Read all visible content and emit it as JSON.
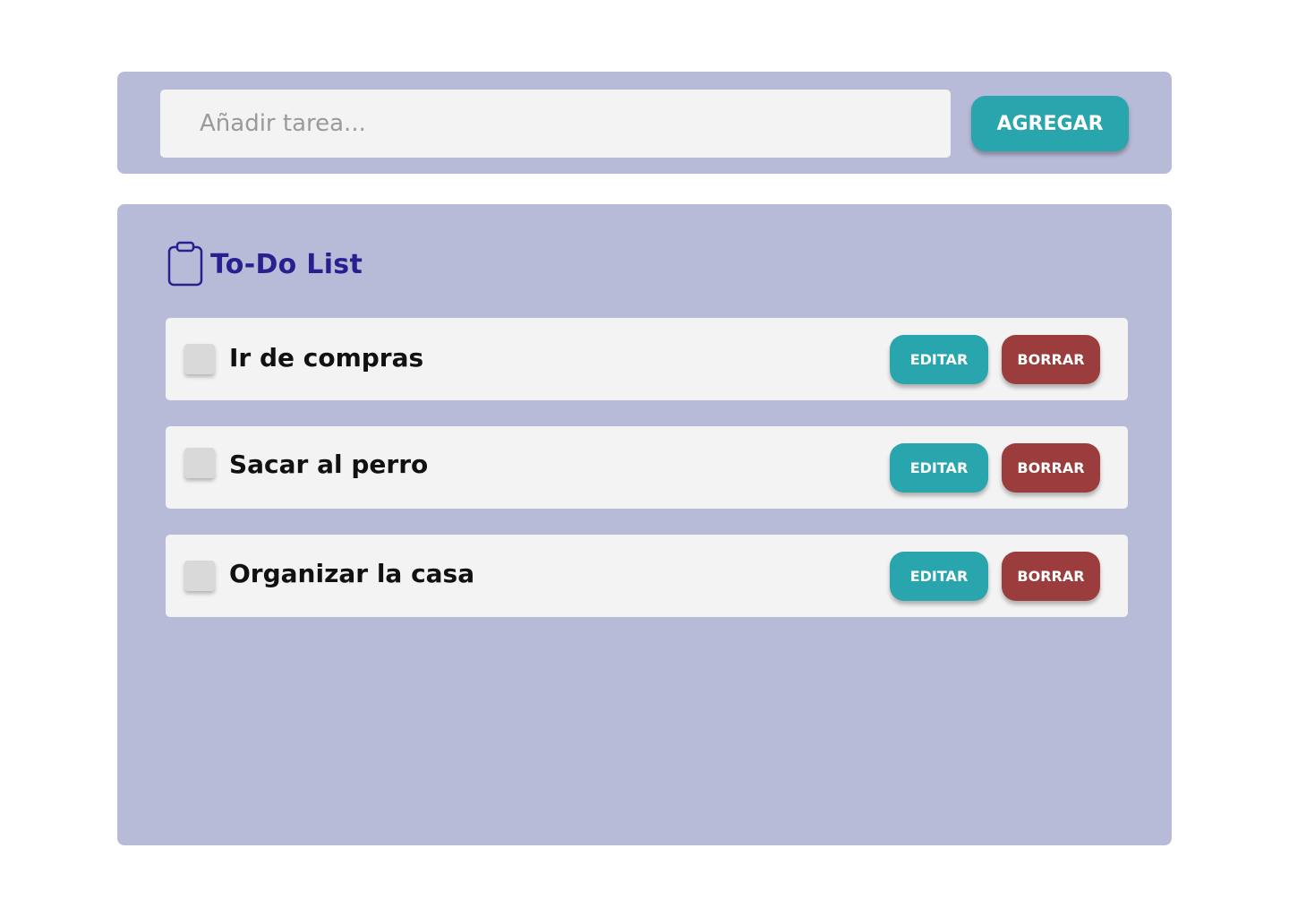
{
  "add_bar": {
    "input_placeholder": "Añadir tarea...",
    "input_value": "",
    "add_label": "AGREGAR"
  },
  "list": {
    "title": "To-Do List",
    "icon": "clipboard-icon",
    "tasks": [
      {
        "text": "Ir de compras",
        "done": false,
        "edit_label": "EDITAR",
        "delete_label": "BORRAR"
      },
      {
        "text": "Sacar al perro",
        "done": false,
        "edit_label": "EDITAR",
        "delete_label": "BORRAR"
      },
      {
        "text": "Organizar la casa",
        "done": false,
        "edit_label": "EDITAR",
        "delete_label": "BORRAR"
      }
    ]
  },
  "colors": {
    "panel_background": "#b7bbd7",
    "row_background": "#f3f3f3",
    "edit_accent": "#29a5ad",
    "delete_accent": "#9b3c3d",
    "title_color": "#2a1f8f"
  }
}
